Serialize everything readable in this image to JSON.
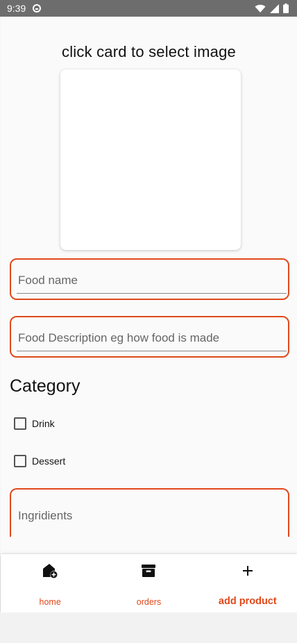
{
  "status_bar": {
    "time": "9:39",
    "icons": [
      "app-notification-icon",
      "wifi-icon",
      "cell-signal-icon",
      "battery-icon"
    ]
  },
  "form": {
    "image_hint": "click card to select image",
    "food_name_placeholder": "Food name",
    "food_description_placeholder": "Food Description eg how food is made",
    "category_heading": "Category",
    "categories": [
      {
        "label": "Drink",
        "checked": false
      },
      {
        "label": "Dessert",
        "checked": false
      }
    ],
    "ingredients_placeholder": "Ingridients"
  },
  "bottom_nav": {
    "items": [
      {
        "label": "home",
        "icon": "add-home-icon",
        "active": false
      },
      {
        "label": "orders",
        "icon": "store-icon",
        "active": false
      },
      {
        "label": "add product",
        "icon": "plus-icon",
        "active": true
      }
    ]
  },
  "colors": {
    "accent": "#e0481b",
    "status_bar": "#6d6d6d",
    "background": "#fafafa"
  }
}
